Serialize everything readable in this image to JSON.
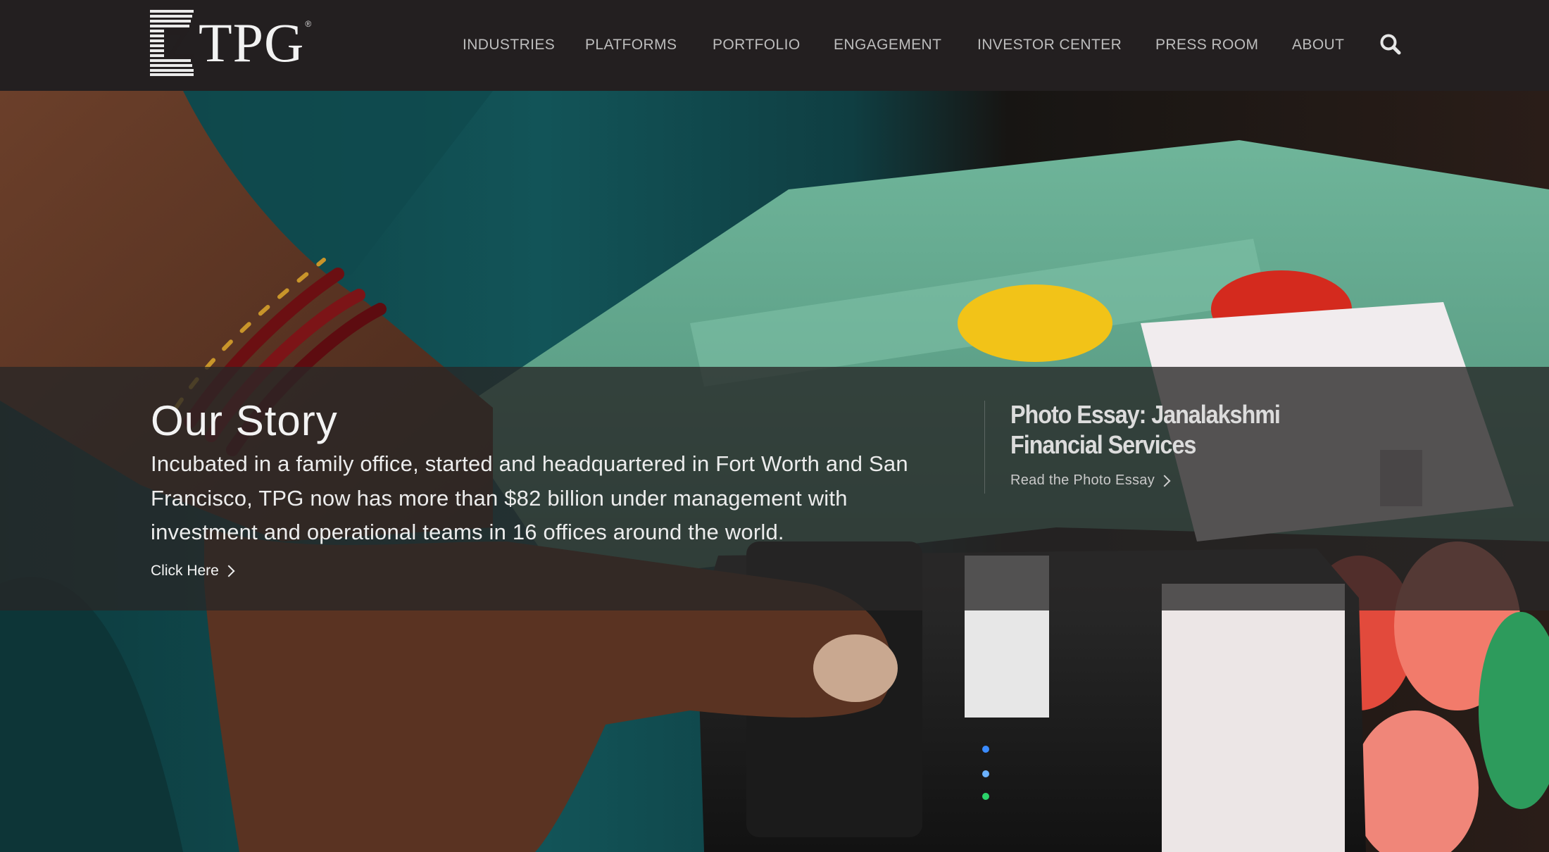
{
  "brand": {
    "logo_text": "TPG",
    "logo_reg": "®"
  },
  "nav": {
    "items": [
      {
        "label": "INDUSTRIES"
      },
      {
        "label": "PLATFORMS"
      },
      {
        "label": "PORTFOLIO"
      },
      {
        "label": "ENGAGEMENT"
      },
      {
        "label": "INVESTOR CENTER"
      },
      {
        "label": "PRESS ROOM"
      },
      {
        "label": "ABOUT"
      }
    ],
    "search_icon": "search-icon"
  },
  "hero": {
    "story": {
      "title": "Our Story",
      "body": "Incubated in a family office, started and headquartered in Fort Worth and San Francisco, TPG now has more than $82 billion under management with investment and operational teams in 16 offices around the world.",
      "link_label": "Click Here"
    },
    "essay": {
      "title": "Photo Essay: Janalakshmi Financial Services",
      "link_label": "Read the Photo Essay"
    }
  },
  "colors": {
    "header_bg": "#231f20",
    "nav_text": "#bdbdbd",
    "overlay_band": "rgba(40,38,38,0.78)"
  }
}
